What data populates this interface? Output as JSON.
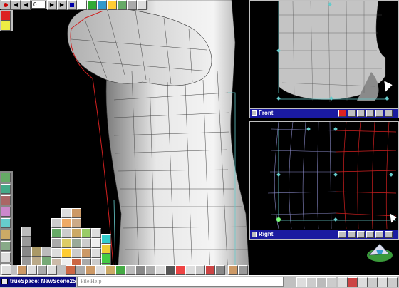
{
  "colors": {
    "titlebar": "#1a1aa0",
    "chrome": "#c0c0c0",
    "mesh_red": "#d02020",
    "mesh_cyan": "#80c8c8",
    "viewport_bg": "#000000"
  },
  "top_toolbar": {
    "frame_value": "0"
  },
  "viewports": {
    "front": {
      "title": "Front"
    },
    "right": {
      "title": "Right"
    }
  },
  "taskbar": {
    "app_title": "trueSpace: NewScene25"
  },
  "help_bar": {
    "items": [
      "File",
      "Help"
    ]
  },
  "icons": [
    "record-icon",
    "play-icon",
    "rewind-icon",
    "forward-icon",
    "stop-icon",
    "object-tool-icon",
    "paint-icon",
    "render-icon",
    "close-icon",
    "camera-icon",
    "light-icon",
    "material-icon",
    "navigation-icon"
  ]
}
